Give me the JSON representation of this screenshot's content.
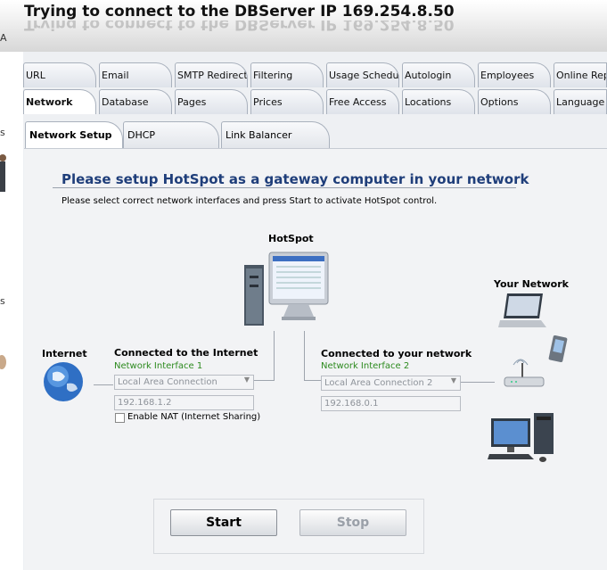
{
  "window": {
    "title": "Trying to connect to the DBServer IP 169.254.8.50"
  },
  "left_strip": {
    "glyphs": [
      "A",
      "s",
      "s"
    ]
  },
  "tabs_row1": [
    "URL",
    "Email",
    "SMTP Redirect",
    "Filtering",
    "Usage Schedule",
    "Autologin",
    "Employees",
    "Online Repo"
  ],
  "tabs_row2": [
    "Network",
    "Database",
    "Pages",
    "Prices",
    "Free Access",
    "Locations",
    "Options",
    "Language"
  ],
  "subtabs": [
    "Network Setup",
    "DHCP",
    "Link Balancer"
  ],
  "main": {
    "heading": "Please setup HotSpot as a gateway computer in your network",
    "instructions": "Please select correct network interfaces and press Start to activate HotSpot control.",
    "hotspot_label": "HotSpot",
    "internet_label": "Internet",
    "your_network_label": "Your Network",
    "left_panel": {
      "title": "Connected to the Internet",
      "interface_label": "Network Interface 1",
      "connection": "Local Area Connection",
      "ip": "192.168.1.2",
      "nat_label": "Enable NAT (Internet Sharing)"
    },
    "right_panel": {
      "title": "Connected to your network",
      "interface_label": "Network Interface 2",
      "connection": "Local Area Connection 2",
      "ip": "192.168.0.1"
    },
    "buttons": {
      "start": "Start",
      "stop": "Stop"
    }
  },
  "colors": {
    "heading": "#1f3e7a",
    "interface_label": "#2c8a1e",
    "disabled_text": "#8e939a"
  }
}
